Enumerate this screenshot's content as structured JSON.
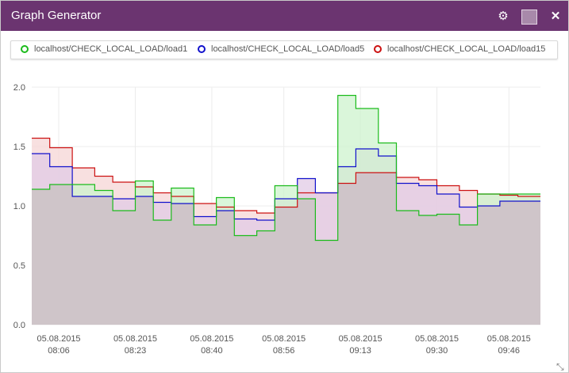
{
  "window": {
    "title": "Graph Generator",
    "icons": [
      "gear-icon",
      "color-swatch",
      "close-icon"
    ],
    "accent": "#6b3470"
  },
  "legend": [
    {
      "label": "localhost/CHECK_LOCAL_LOAD/load1",
      "color": "#1bbb1b"
    },
    {
      "label": "localhost/CHECK_LOCAL_LOAD/load5",
      "color": "#1111cc"
    },
    {
      "label": "localhost/CHECK_LOCAL_LOAD/load15",
      "color": "#cc1111"
    }
  ],
  "chart_data": {
    "type": "area",
    "ylim": [
      0,
      2.0
    ],
    "yticks": [
      "0.0",
      "0.5",
      "1.0",
      "1.5",
      "2.0"
    ],
    "grid": true,
    "xticks": [
      {
        "date": "05.08.2015",
        "time": "08:06"
      },
      {
        "date": "05.08.2015",
        "time": "08:23"
      },
      {
        "date": "05.08.2015",
        "time": "08:40"
      },
      {
        "date": "05.08.2015",
        "time": "08:56"
      },
      {
        "date": "05.08.2015",
        "time": "09:13"
      },
      {
        "date": "05.08.2015",
        "time": "09:30"
      },
      {
        "date": "05.08.2015",
        "time": "09:46"
      }
    ],
    "x": [
      "08:00",
      "08:04",
      "08:09",
      "08:14",
      "08:18",
      "08:23",
      "08:27",
      "08:31",
      "08:36",
      "08:41",
      "08:45",
      "08:50",
      "08:54",
      "08:59",
      "09:03",
      "09:08",
      "09:12",
      "09:17",
      "09:21",
      "09:26",
      "09:30",
      "09:35",
      "09:39",
      "09:44",
      "09:48",
      "09:53"
    ],
    "series": [
      {
        "name": "localhost/CHECK_LOCAL_LOAD/load1",
        "color": "#1bbb1b",
        "fill": "#cdf3cd",
        "values": [
          1.14,
          1.18,
          1.18,
          1.13,
          0.96,
          1.21,
          0.88,
          1.15,
          0.84,
          1.07,
          0.75,
          0.79,
          1.17,
          1.06,
          0.71,
          1.93,
          1.82,
          1.53,
          0.96,
          0.92,
          0.93,
          0.84,
          1.1,
          1.1,
          1.1,
          1.1
        ]
      },
      {
        "name": "localhost/CHECK_LOCAL_LOAD/load5",
        "color": "#1111cc",
        "fill": "#e2cbe6",
        "values": [
          1.44,
          1.33,
          1.08,
          1.08,
          1.06,
          1.08,
          1.03,
          1.02,
          0.91,
          0.96,
          0.89,
          0.88,
          1.06,
          1.23,
          1.11,
          1.33,
          1.48,
          1.42,
          1.19,
          1.17,
          1.1,
          0.99,
          1.0,
          1.04,
          1.04,
          1.04
        ]
      },
      {
        "name": "localhost/CHECK_LOCAL_LOAD/load15",
        "color": "#cc1111",
        "fill": "#f6d6d6",
        "values": [
          1.57,
          1.49,
          1.32,
          1.25,
          1.2,
          1.16,
          1.11,
          1.08,
          1.02,
          0.99,
          0.96,
          0.94,
          0.99,
          1.11,
          1.11,
          1.19,
          1.28,
          1.28,
          1.24,
          1.22,
          1.17,
          1.13,
          1.1,
          1.09,
          1.08,
          1.08
        ]
      }
    ]
  }
}
